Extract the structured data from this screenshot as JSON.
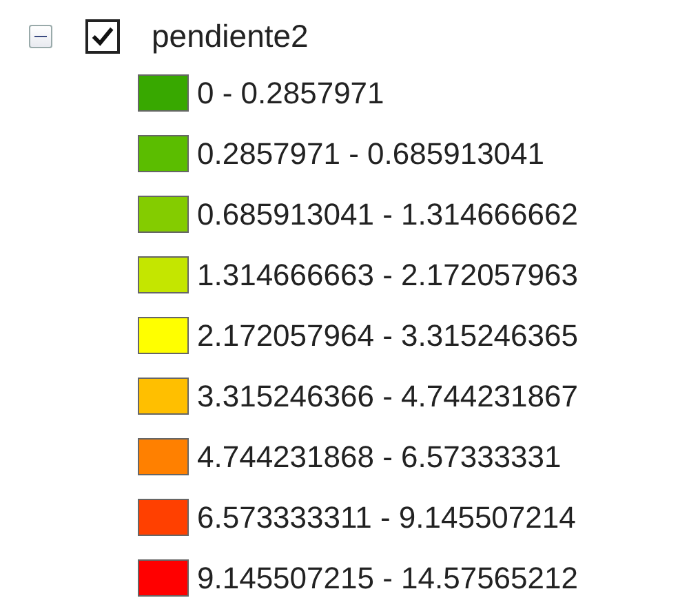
{
  "layer": {
    "name": "pendiente2",
    "expanded": true,
    "checked": true,
    "classes": [
      {
        "label": "0 - 0.2857971",
        "color": "#38a800"
      },
      {
        "label": "0.2857971 - 0.685913041",
        "color": "#5bbd00"
      },
      {
        "label": "0.685913041 - 1.314666662",
        "color": "#84cc00"
      },
      {
        "label": "1.314666663 - 2.172057963",
        "color": "#c4e600"
      },
      {
        "label": "2.172057964 - 3.315246365",
        "color": "#ffff00"
      },
      {
        "label": "3.315246366 - 4.744231867",
        "color": "#ffbf00"
      },
      {
        "label": "4.744231868 - 6.57333331",
        "color": "#ff8000"
      },
      {
        "label": "6.573333311 - 9.145507214",
        "color": "#ff4000"
      },
      {
        "label": "9.145507215 - 14.57565212",
        "color": "#ff0000"
      }
    ]
  }
}
